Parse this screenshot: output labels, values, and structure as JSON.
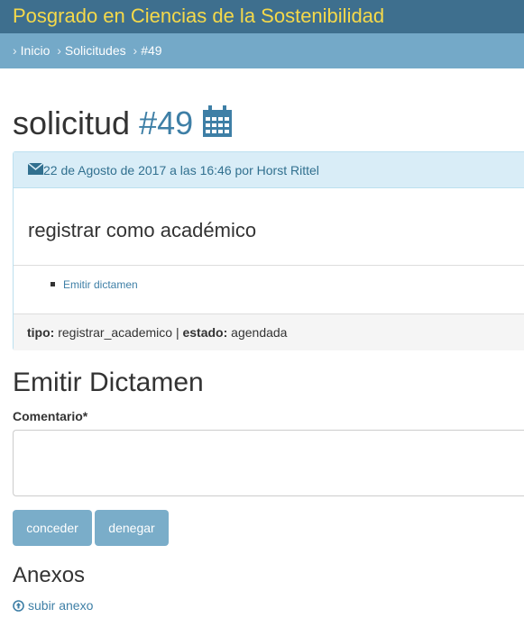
{
  "header": {
    "brand": "Posgrado en Ciencias de la Sostenibilidad"
  },
  "breadcrumb": {
    "separator": "›",
    "items": [
      {
        "label": "Inicio"
      },
      {
        "label": "Solicitudes"
      },
      {
        "label": "#49"
      }
    ]
  },
  "page": {
    "title_word": "solicitud",
    "title_number": "#49",
    "calendar_icon": "calendar-icon"
  },
  "request": {
    "icon": "envelope-icon",
    "meta": "22 de Agosto de 2017 a las 16:46 por Horst Rittel",
    "subject": "registrar como académico",
    "actions": [
      {
        "label": "Emitir dictamen"
      }
    ],
    "type_label": "tipo:",
    "type_value": "registrar_academico",
    "divider": "|",
    "status_label": "estado:",
    "status_value": "agendada"
  },
  "dictamen": {
    "heading": "Emitir Dictamen",
    "comment_label": "Comentario*",
    "comment_value": "",
    "grant_label": "conceder",
    "deny_label": "denegar"
  },
  "attachments": {
    "heading": "Anexos",
    "upload_icon": "upload-circle-icon",
    "upload_label": "subir anexo"
  },
  "colors": {
    "topbar": "#3e6f8e",
    "brand_text": "#f5d94a",
    "breadcrumb_bar": "#74a9c8",
    "accent": "#3e7fa6",
    "panel_head": "#d9edf7",
    "button": "#7aadc9"
  }
}
